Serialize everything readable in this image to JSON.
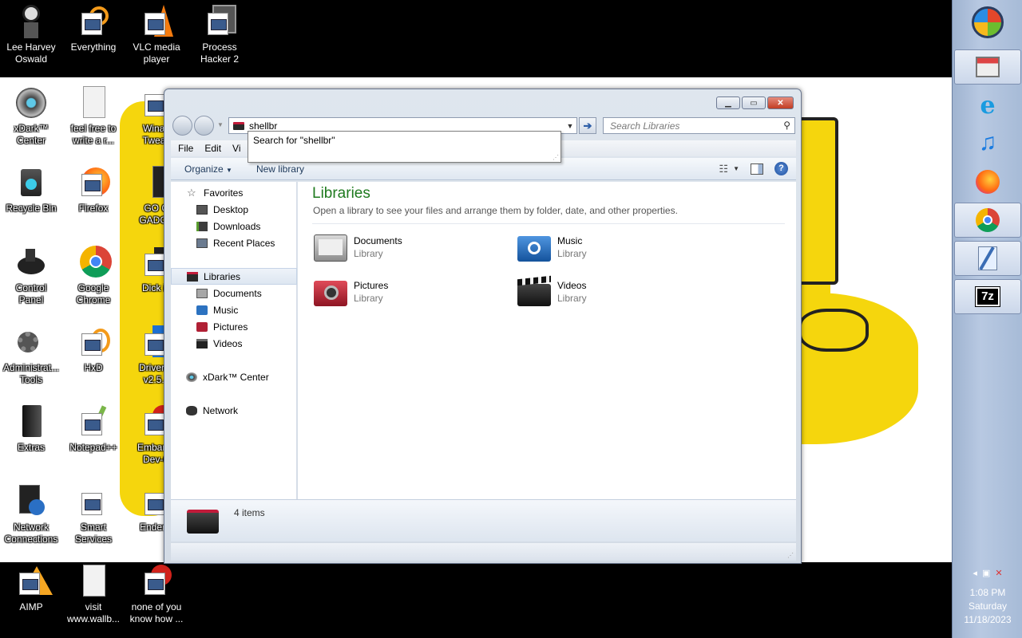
{
  "desktop": {
    "icons": [
      {
        "label": "Lee Harvey\nOswald"
      },
      {
        "label": "Everything"
      },
      {
        "label": "VLC media\nplayer"
      },
      {
        "label": "Process\nHacker 2"
      },
      {
        "label": "xDark™\nCenter"
      },
      {
        "label": "feel free to\nwrite a r..."
      },
      {
        "label": "Winae\nTweak"
      },
      {
        "label": "Recycle Bin"
      },
      {
        "label": "Firefox"
      },
      {
        "label": "GO G\nGADGE"
      },
      {
        "label": "Control\nPanel"
      },
      {
        "label": "Google\nChrome"
      },
      {
        "label": "Dick in"
      },
      {
        "label": "Administrat...\nTools"
      },
      {
        "label": "HxD"
      },
      {
        "label": "Driver R\nv2.5.4"
      },
      {
        "label": "Extras"
      },
      {
        "label": "Notepad++"
      },
      {
        "label": "Embarca\nDev-C"
      },
      {
        "label": "Network\nConnections"
      },
      {
        "label": "Smart\nServices"
      },
      {
        "label": "Enderm"
      },
      {
        "label": "AIMP"
      },
      {
        "label": "visit\nwww.wallb..."
      },
      {
        "label": "none of you\nknow how ..."
      }
    ]
  },
  "sidebar": {
    "items": [
      "start-orb-icon",
      "store-icon",
      "internet-explorer-icon",
      "music-note-icon",
      "firefox-icon",
      "chrome-icon",
      "notepad-icon",
      "7zip-icon"
    ],
    "tray": {
      "time": "1:08 PM",
      "day": "Saturday",
      "date": "11/18/2023"
    }
  },
  "window": {
    "address_value": "shellbr",
    "search_placeholder": "Search Libraries",
    "suggestion": "Search for \"shellbr\"",
    "menu": [
      "File",
      "Edit",
      "Vi"
    ],
    "commands": {
      "organize": "Organize",
      "new_library": "New library"
    },
    "nav": {
      "favorites": "Favorites",
      "desktop": "Desktop",
      "downloads": "Downloads",
      "recent": "Recent Places",
      "libraries": "Libraries",
      "documents": "Documents",
      "music": "Music",
      "pictures": "Pictures",
      "videos": "Videos",
      "xdark": "xDark™ Center",
      "network": "Network"
    },
    "content": {
      "title": "Libraries",
      "subtitle": "Open a library to see your files and arrange them by folder, date, and other properties.",
      "libraries": [
        {
          "name": "Documents",
          "type": "Library"
        },
        {
          "name": "Music",
          "type": "Library"
        },
        {
          "name": "Pictures",
          "type": "Library"
        },
        {
          "name": "Videos",
          "type": "Library"
        }
      ]
    },
    "details": {
      "count": "4 items"
    }
  },
  "colors": {
    "accent_green": "#1e7a1e",
    "wallpaper_yellow": "#f5d60d",
    "sidebar_blue": "#b8c9e2"
  }
}
